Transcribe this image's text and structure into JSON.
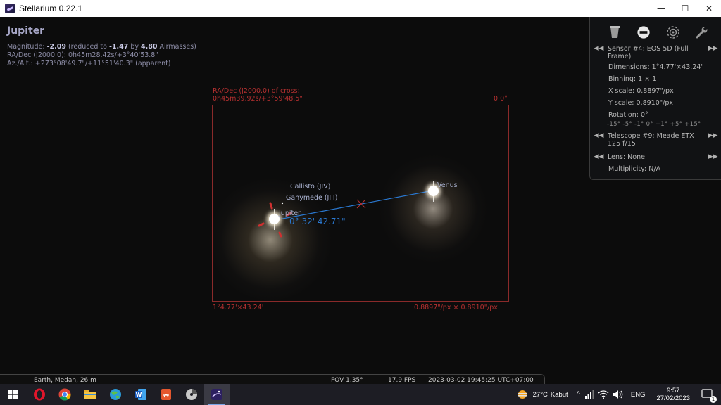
{
  "window": {
    "title": "Stellarium 0.22.1",
    "controls": {
      "minimize": "—",
      "maximize": "☐",
      "close": "✕"
    }
  },
  "object_info": {
    "name": "Jupiter",
    "magnitude_label": "Magnitude: ",
    "magnitude_value": "-2.09",
    "reduced_label": " (reduced to ",
    "reduced_value": "-1.47",
    "by_label": " by ",
    "airmass_value": "4.80",
    "airmass_label": " Airmasses)",
    "radec": "RA/Dec (J2000.0): 0h45m28.42s/+3°40'53.8\"",
    "azalt": "Az./Alt.: +273°08'49.7\"/+11°51'40.3\" (apparent)"
  },
  "ccd_overlay": {
    "radec_label": "RA/Dec (J2000.0) of cross:",
    "radec_value": "0h45m39.92s/+3°59'48.5\"",
    "rotation": "0.0°",
    "dimensions": "1°4.77'×43.24'",
    "scale": "0.8897\"/px × 0.8910\"/px"
  },
  "sky_labels": {
    "callisto": "Callisto (JIV)",
    "ganymede": "Ganymede (JIII)",
    "jupiter": "Jupiter",
    "venus": "Venus",
    "angular_distance": "0° 32' 42.71\""
  },
  "oculars_panel": {
    "icons": [
      "ocular-icon",
      "sensor-icon",
      "telrad-icon",
      "wrench-icon"
    ],
    "sensor": "Sensor #4: EOS 5D (Full Frame)",
    "dimensions": "Dimensions: 1°4.77'×43.24'",
    "binning": "Binning: 1 × 1",
    "x_scale": "X scale: 0.8897\"/px",
    "y_scale": "Y scale: 0.8910\"/px",
    "rotation": "Rotation: 0°",
    "rotation_steps": "-15°  -5°  -1°  0°  +1°  +5°  +15°",
    "telescope": "Telescope #9: Meade ETX 125 f/15",
    "lens": "Lens: None",
    "multiplicity": "Multiplicity: N/A",
    "prev_arrow": "◀◀",
    "next_arrow": "▶▶"
  },
  "statusbar": {
    "location": "Earth, Medan, 26 m",
    "fov": "FOV 1.35°",
    "fps": "17.9 FPS",
    "datetime": "2023-03-02 19:45:25 UTC+07:00"
  },
  "taskbar": {
    "apps": [
      "opera",
      "chrome",
      "file-explorer",
      "edge-legacy",
      "word",
      "adobe-acrobat",
      "disk-tool",
      "stellarium"
    ],
    "weather_temp": "27°C",
    "weather_desc": "Kabut",
    "chevron": "^",
    "language": "ENG",
    "time": "9:57",
    "date": "27/02/2023",
    "notifications": "1"
  },
  "colors": {
    "ccd_red": "#b53030",
    "measure_blue": "#2a78d0",
    "info_text": "#8e8ea8"
  }
}
